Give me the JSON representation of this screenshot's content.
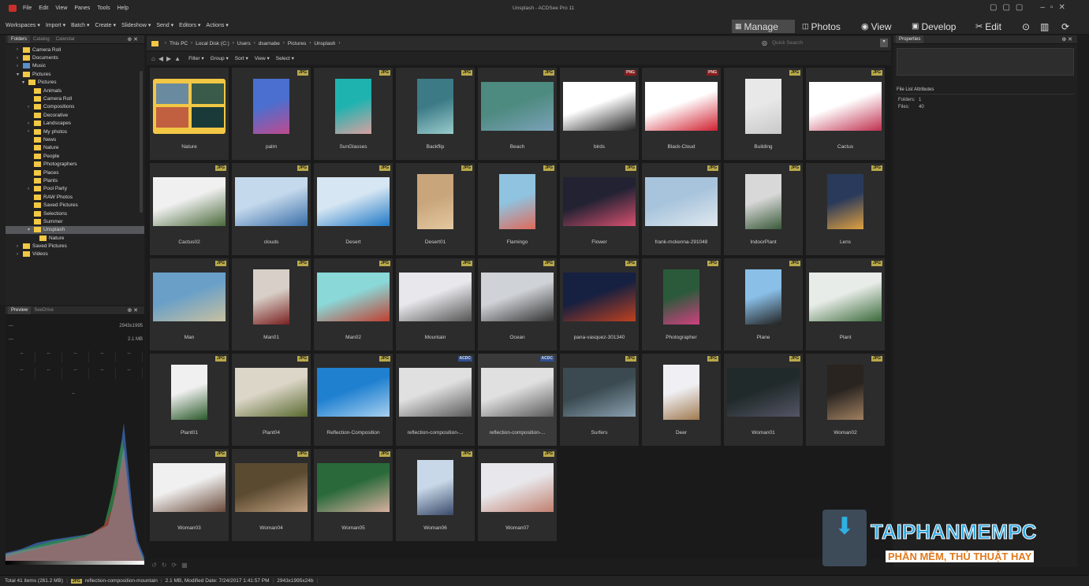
{
  "app": {
    "title": "Unsplash - ACDSee Pro 11",
    "menu": [
      "File",
      "Edit",
      "View",
      "Panes",
      "Tools",
      "Help"
    ]
  },
  "toolbar": {
    "items": [
      "Workspaces ▾",
      "Import ▾",
      "Batch ▾",
      "Create ▾",
      "Slideshow ▾",
      "Send ▾",
      "Editors ▾",
      "Actions ▾"
    ]
  },
  "modes": [
    "Manage",
    "Photos",
    "View",
    "Develop",
    "Edit"
  ],
  "folders": {
    "tabs": [
      "Folders",
      "Catalog",
      "Calendar"
    ],
    "items": [
      {
        "label": "Camera Roll",
        "level": 2,
        "type": "folder",
        "exp": "›"
      },
      {
        "label": "Documents",
        "level": 2,
        "type": "folder",
        "exp": "›"
      },
      {
        "label": "Music",
        "level": 2,
        "type": "drive",
        "exp": "›"
      },
      {
        "label": "Pictures",
        "level": 2,
        "type": "folder",
        "exp": "▾"
      },
      {
        "label": "Pictures",
        "level": 3,
        "type": "folder",
        "exp": "▾"
      },
      {
        "label": "Animals",
        "level": 4,
        "type": "folder",
        "exp": ""
      },
      {
        "label": "Camera Roll",
        "level": 4,
        "type": "folder",
        "exp": ""
      },
      {
        "label": "Compositions",
        "level": 4,
        "type": "folder",
        "exp": "›"
      },
      {
        "label": "Decorative",
        "level": 4,
        "type": "folder",
        "exp": ""
      },
      {
        "label": "Landscapes",
        "level": 4,
        "type": "folder",
        "exp": "›"
      },
      {
        "label": "My photos",
        "level": 4,
        "type": "folder",
        "exp": "›"
      },
      {
        "label": "News",
        "level": 4,
        "type": "folder",
        "exp": ""
      },
      {
        "label": "Nature",
        "level": 4,
        "type": "folder",
        "exp": ""
      },
      {
        "label": "People",
        "level": 4,
        "type": "folder",
        "exp": ""
      },
      {
        "label": "Photographers",
        "level": 4,
        "type": "folder",
        "exp": ""
      },
      {
        "label": "Places",
        "level": 4,
        "type": "folder",
        "exp": ""
      },
      {
        "label": "Plants",
        "level": 4,
        "type": "folder",
        "exp": ""
      },
      {
        "label": "Pool Party",
        "level": 4,
        "type": "folder",
        "exp": "›"
      },
      {
        "label": "RAW Photos",
        "level": 4,
        "type": "folder",
        "exp": ""
      },
      {
        "label": "Saved Pictures",
        "level": 4,
        "type": "folder",
        "exp": ""
      },
      {
        "label": "Selections",
        "level": 4,
        "type": "folder",
        "exp": ""
      },
      {
        "label": "Summer",
        "level": 4,
        "type": "folder",
        "exp": ""
      },
      {
        "label": "Unsplash",
        "level": 4,
        "type": "folder",
        "exp": "▾",
        "selected": true
      },
      {
        "label": "Nature",
        "level": 5,
        "type": "folder",
        "exp": ""
      },
      {
        "label": "Saved Pictures",
        "level": 2,
        "type": "folder",
        "exp": "›"
      },
      {
        "label": "Videos",
        "level": 2,
        "type": "folder",
        "exp": "›"
      }
    ]
  },
  "preview": {
    "tabs": [
      "Preview",
      "SeeDrive"
    ],
    "dimensions": "2943x1995",
    "size": "2.1 MB",
    "placeholder1": "---",
    "placeholder2": "---",
    "dashes": [
      "--",
      "--",
      "--",
      "--",
      "--",
      "--",
      "--",
      "--",
      "--",
      "--"
    ],
    "center": "--"
  },
  "breadcrumb": [
    "This PC",
    "Local Disk (C:)",
    "Users",
    "dsarnabe",
    "Pictures",
    "Unsplash"
  ],
  "search": {
    "placeholder": "Quick Search"
  },
  "filterbar": [
    "Filter ▾",
    "Group ▾",
    "Sort ▾",
    "View ▾",
    "Select ▾"
  ],
  "colors": {
    "jpg_badge": "#b9a94a",
    "png_badge": "#8c1c1c",
    "acdc_badge": "#2f4f8f",
    "selection": "#56575a",
    "folder": "#f2c744"
  },
  "thumbs": [
    {
      "name": "Nature",
      "badge": "",
      "kind": "folder"
    },
    {
      "name": "palm",
      "badge": "JPG",
      "c": [
        "#4a6fd0",
        "#c04a8e"
      ],
      "o": "p"
    },
    {
      "name": "SunGlasses",
      "badge": "JPG",
      "c": [
        "#1fb3b0",
        "#d8a0a0"
      ],
      "o": "p"
    },
    {
      "name": "Backflip",
      "badge": "JPG",
      "c": [
        "#3c7a86",
        "#9cc"
      ],
      "o": "p"
    },
    {
      "name": "Beach",
      "badge": "JPG",
      "c": [
        "#4d8a7f",
        "#7aa2b8"
      ],
      "o": "l"
    },
    {
      "name": "birds",
      "badge": "PNG",
      "c": [
        "#ffffff",
        "#222"
      ],
      "o": "l",
      "type": "png"
    },
    {
      "name": "Black-Cloud",
      "badge": "PNG",
      "c": [
        "#ffffff",
        "#d02030"
      ],
      "o": "l",
      "type": "png"
    },
    {
      "name": "Building",
      "badge": "JPG",
      "c": [
        "#e8e8e8",
        "#c8c8c8"
      ],
      "o": "p"
    },
    {
      "name": "Cactus",
      "badge": "JPG",
      "c": [
        "#ffffff",
        "#c03050"
      ],
      "o": "l"
    },
    {
      "name": "Cactus02",
      "badge": "JPG",
      "c": [
        "#f0f0f0",
        "#4a6a3a"
      ],
      "o": "l"
    },
    {
      "name": "clouds",
      "badge": "JPG",
      "c": [
        "#c5d9ec",
        "#3a6fa8"
      ],
      "o": "l"
    },
    {
      "name": "Desert",
      "badge": "JPG",
      "c": [
        "#d6e6f2",
        "#1f78c6"
      ],
      "o": "l"
    },
    {
      "name": "Desert01",
      "badge": "JPG",
      "c": [
        "#c8a57a",
        "#e4c8a0"
      ],
      "o": "p"
    },
    {
      "name": "Flamingo",
      "badge": "JPG",
      "c": [
        "#8fc3e0",
        "#e06a5a"
      ],
      "o": "p"
    },
    {
      "name": "Flower",
      "badge": "JPG",
      "c": [
        "#223",
        "#d85070"
      ],
      "o": "l"
    },
    {
      "name": "frank-mckenna-291048",
      "badge": "JPG",
      "c": [
        "#a8c4dc",
        "#dfe8ef"
      ],
      "o": "l"
    },
    {
      "name": "IndoorPlant",
      "badge": "JPG",
      "c": [
        "#d8d8d8",
        "#3a5a3a"
      ],
      "o": "p"
    },
    {
      "name": "Lens",
      "badge": "JPG",
      "c": [
        "#2a3a5a",
        "#e0a040"
      ],
      "o": "p"
    },
    {
      "name": "Man",
      "badge": "JPG",
      "c": [
        "#6aa0c8",
        "#c8c0a0"
      ],
      "o": "l"
    },
    {
      "name": "Man01",
      "badge": "JPG",
      "c": [
        "#d8d0c8",
        "#7a2020"
      ],
      "o": "p"
    },
    {
      "name": "Man02",
      "badge": "JPG",
      "c": [
        "#8ad8d8",
        "#c04030"
      ],
      "o": "l"
    },
    {
      "name": "Mountain",
      "badge": "JPG",
      "c": [
        "#e8e8ec",
        "#555"
      ],
      "o": "l"
    },
    {
      "name": "Ocean",
      "badge": "JPG",
      "c": [
        "#cfd2d6",
        "#333"
      ],
      "o": "l"
    },
    {
      "name": "pana-vasquez-301340",
      "badge": "JPG",
      "c": [
        "#162040",
        "#c04020"
      ],
      "o": "l"
    },
    {
      "name": "Photographer",
      "badge": "JPG",
      "c": [
        "#2a5a3a",
        "#d04080"
      ],
      "o": "p"
    },
    {
      "name": "Plane",
      "badge": "JPG",
      "c": [
        "#8ac0e8",
        "#222"
      ],
      "o": "p"
    },
    {
      "name": "Plant",
      "badge": "JPG",
      "c": [
        "#e8ece8",
        "#3a6a3a"
      ],
      "o": "l"
    },
    {
      "name": "Plant01",
      "badge": "JPG",
      "c": [
        "#f0f0f0",
        "#2a5a2a"
      ],
      "o": "p"
    },
    {
      "name": "Plant04",
      "badge": "JPG",
      "c": [
        "#dcd6c8",
        "#5a6a30"
      ],
      "o": "l"
    },
    {
      "name": "Reflection-Composition",
      "badge": "JPG",
      "c": [
        "#1f80d0",
        "#a8d0f0"
      ],
      "o": "l"
    },
    {
      "name": "reflection-composition-...",
      "badge": "ACDC",
      "c": [
        "#e0e0e0",
        "#5a5a5a"
      ],
      "o": "l",
      "type": "acdc"
    },
    {
      "name": "reflection-composition-...",
      "badge": "ACDC",
      "c": [
        "#e0e0e0",
        "#5a5a5a"
      ],
      "o": "l",
      "type": "acdc"
    },
    {
      "name": "Surfers",
      "badge": "JPG",
      "c": [
        "#3a4a50",
        "#8aa0b0"
      ],
      "o": "l"
    },
    {
      "name": "Deer",
      "badge": "JPG",
      "c": [
        "#f0f0f4",
        "#a07a50"
      ],
      "o": "p"
    },
    {
      "name": "Woman01",
      "badge": "JPG",
      "c": [
        "#202a2a",
        "#556"
      ],
      "o": "l"
    },
    {
      "name": "Woman02",
      "badge": "JPG",
      "c": [
        "#2a2420",
        "#a08060"
      ],
      "o": "p"
    },
    {
      "name": "Woman03",
      "badge": "JPG",
      "c": [
        "#f0f0f0",
        "#6a4a3a"
      ],
      "o": "l"
    },
    {
      "name": "Woman04",
      "badge": "JPG",
      "c": [
        "#5a4a30",
        "#c0a080"
      ],
      "o": "l"
    },
    {
      "name": "Woman05",
      "badge": "JPG",
      "c": [
        "#2a6a3a",
        "#d8b0a0"
      ],
      "o": "l"
    },
    {
      "name": "Woman06",
      "badge": "JPG",
      "c": [
        "#c8d8e8",
        "#3a4a6a"
      ],
      "o": "p"
    },
    {
      "name": "Woman07",
      "badge": "JPG",
      "c": [
        "#e8e8ec",
        "#c08070"
      ],
      "o": "l"
    }
  ],
  "properties": {
    "title": "Properties",
    "section": "File List Attributes",
    "rows": [
      {
        "k": "Folders:",
        "v": "1"
      },
      {
        "k": "Files:",
        "v": "40"
      }
    ]
  },
  "status": {
    "total": "Total 41 items (261.2 MB)",
    "badge": "JPG",
    "file": "reflection-composition-mountain",
    "info": "2.1 MB, Modified Date: 7/24/2017 1:41:57 PM",
    "dims": "2943x1995x24b"
  },
  "watermark": {
    "brand": "TAIPHANMEMPC",
    "tagline": "PHẦN MỀM, THỦ THUẬT HAY"
  }
}
